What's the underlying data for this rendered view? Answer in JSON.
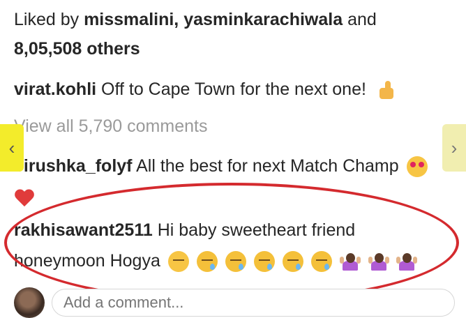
{
  "likes": {
    "prefix": "Liked by",
    "users": "missmalini, yasminkarachiwala",
    "and": "and",
    "count": "8,05,508 others"
  },
  "caption": {
    "username": "virat.kohli",
    "text": "Off to Cape Town for the next one!",
    "emoji": "thumbs-up-icon"
  },
  "view_all": "View all 5,790 comments",
  "comments": [
    {
      "username": "virushka_folyf",
      "text": "All the best for next Match Champ",
      "emojis": [
        "heart-eyes-icon",
        "red-heart-icon"
      ]
    },
    {
      "username": "rakhisawant2511",
      "text_line1": "Hi baby sweetheart friend",
      "text_line2": "honeymoon Hogya",
      "emojis": [
        "pensive-face-icon",
        "sleepy-face-icon",
        "sleepy-face-icon",
        "sleepy-face-icon",
        "sleepy-face-icon",
        "sleepy-face-icon",
        "person-shrugging-icon",
        "person-shrugging-icon",
        "person-shrugging-icon"
      ]
    }
  ],
  "add_comment": {
    "placeholder": "Add a comment..."
  },
  "colors": {
    "highlight_oval": "#d42a2e",
    "nav_left": "#f3ec2b",
    "nav_right": "#f1eeb0",
    "muted_text": "#9a9a9a"
  },
  "nav": {
    "prev": "‹",
    "next": "›"
  }
}
